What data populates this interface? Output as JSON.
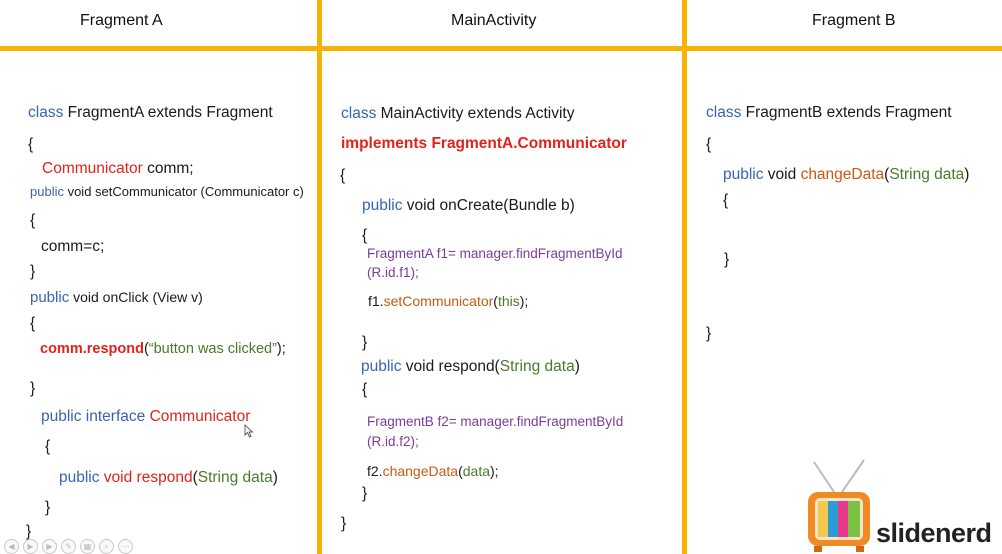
{
  "columns": {
    "a_title": "Fragment A",
    "main_title": "MainActivity",
    "b_title": "Fragment B"
  },
  "fragment_a": {
    "l1_kw": "class",
    "l1_rest": " FragmentA extends Fragment",
    "l2": "{",
    "l3_type": "Communicator",
    "l3_rest": " comm;",
    "l4_kw": "public",
    "l4_rest": " void setCommunicator (Communicator c)",
    "l5": "{",
    "l6": "comm=c;",
    "l7": "}",
    "l8_kw": "public",
    "l8_rest": " void onClick (View v)",
    "l9": "{",
    "l10_call": "comm.respond",
    "l10_open": "(",
    "l10_str": "“button was clicked”",
    "l10_close": ");",
    "l11": "}",
    "l12_kw": "public interface",
    "l12_name": " Communicator",
    "l13": "{",
    "l14_kw": "public",
    "l14_method": " void respond",
    "l14_open": "(",
    "l14_param": "String data",
    "l14_close": ")",
    "l15": "}",
    "l16": "}"
  },
  "main_activity": {
    "l1_kw": "class",
    "l1_rest": " MainActivity extends Activity",
    "l2": "implements FragmentA.Communicator",
    "l3": "{",
    "l4_kw": "public",
    "l4_rest": " void onCreate(Bundle b)",
    "l5": "{",
    "l6": "FragmentA f1= manager.findFragmentById",
    "l7": "(R.id.f1);",
    "l8_obj": "f1.",
    "l8_method": "setCommunicator",
    "l8_open": "(",
    "l8_arg": "this",
    "l8_close": ");",
    "l9": "}",
    "l10_kw": "public",
    "l10_rest": " void respond(",
    "l10_param": "String data",
    "l10_close": ")",
    "l11": "{",
    "l12": "FragmentB f2= manager.findFragmentById",
    "l13": "(R.id.f2);",
    "l14_obj": "f2.",
    "l14_method": "changeData",
    "l14_open": "(",
    "l14_arg": "data",
    "l14_close": ");",
    "l15": "}",
    "l16": "}"
  },
  "fragment_b": {
    "l1_kw": "class",
    "l1_rest": " FragmentB extends Fragment",
    "l2": "{",
    "l3_kw": "public",
    "l3_rest": " void ",
    "l3_method": "changeData",
    "l3_open": "(",
    "l3_param": "String data",
    "l3_close": ")",
    "l4": "{",
    "l5": "}",
    "l6": "}"
  },
  "logo": {
    "text": "slidenerd",
    "stripe_colors": [
      "#f2c94c",
      "#2f9bd6",
      "#e9398b",
      "#7cc242"
    ]
  },
  "player_controls": [
    "prev-icon",
    "play-icon",
    "next-icon",
    "pen-icon",
    "slides-icon",
    "zoom-icon",
    "more-icon"
  ]
}
